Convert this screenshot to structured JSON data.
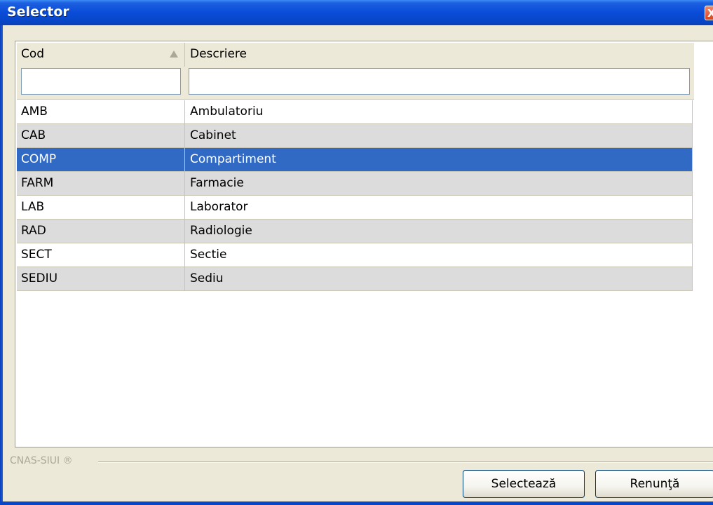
{
  "window": {
    "title": "Selector",
    "close_label": "X"
  },
  "grid": {
    "columns": [
      {
        "label": "Cod",
        "sorted": "ascending"
      },
      {
        "label": "Descriere"
      }
    ],
    "filters": {
      "cod_value": "",
      "descriere_value": ""
    },
    "rows": [
      {
        "cod": "AMB",
        "descriere": "Ambulatoriu",
        "selected": false
      },
      {
        "cod": "CAB",
        "descriere": "Cabinet",
        "selected": false
      },
      {
        "cod": "COMP",
        "descriere": "Compartiment",
        "selected": true
      },
      {
        "cod": "FARM",
        "descriere": "Farmacie",
        "selected": false
      },
      {
        "cod": "LAB",
        "descriere": "Laborator",
        "selected": false
      },
      {
        "cod": "RAD",
        "descriere": "Radiologie",
        "selected": false
      },
      {
        "cod": "SECT",
        "descriere": "Sectie",
        "selected": false
      },
      {
        "cod": "SEDIU",
        "descriere": "Sediu",
        "selected": false
      }
    ]
  },
  "footer": {
    "brand": "CNAS-SIUI ®",
    "select_label": "Selectează",
    "cancel_label": "Renunţă"
  },
  "colors": {
    "selection": "#316ac5",
    "titlebar": "#0a4cd8",
    "alt_row": "#dcdcdc"
  }
}
